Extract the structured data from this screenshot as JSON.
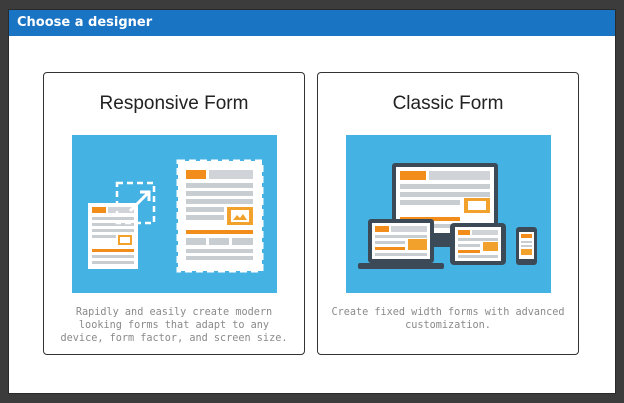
{
  "dialog": {
    "title": "Choose a designer"
  },
  "options": [
    {
      "title": "Responsive Form",
      "description": "Rapidly and easily create modern looking forms that adapt to any device, form factor, and screen size.",
      "illustration": "responsive-layout-illustration"
    },
    {
      "title": "Classic Form",
      "description": "Create fixed width forms with advanced customization.",
      "illustration": "multi-device-illustration"
    }
  ],
  "colors": {
    "title_bar": "#1a74c4",
    "illustration_bg": "#45b2e4",
    "accent_orange": "#f28c1b",
    "device_dark": "#3c4a57"
  }
}
